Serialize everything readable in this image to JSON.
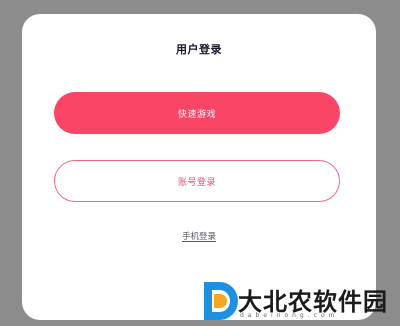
{
  "dialog": {
    "title": "用户登录",
    "quick_game_label": "快速游戏",
    "account_login_label": "账号登录",
    "phone_login_label": "手机登录"
  },
  "watermark": {
    "text": "大北农软件园",
    "subtext": "dabeinong.com",
    "colors": {
      "blue": "#1f8fe0",
      "orange": "#f5a623"
    }
  },
  "colors": {
    "primary": "#f94667",
    "outline": "#f26a82",
    "backdrop": "#8c8c8c"
  }
}
